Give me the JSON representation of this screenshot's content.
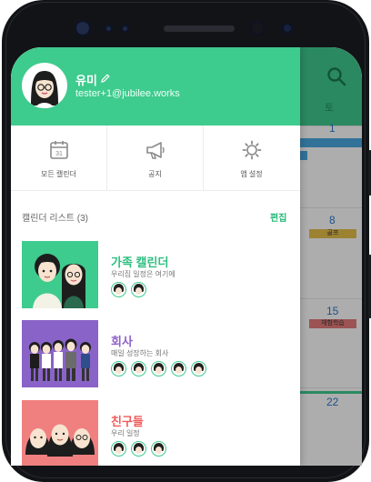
{
  "calendar_bg": {
    "weekday_label": "토",
    "dates": [
      "1",
      "8",
      "15",
      "22"
    ],
    "chips": [
      "골프",
      "체험학습"
    ],
    "colors": {
      "accent": "#3ecb8e",
      "date": "#2c79c9",
      "chip_blue": "#4aa8e0",
      "chip_yellow": "#e8c04a",
      "chip_red": "#e57b7b"
    }
  },
  "user": {
    "name": "유미",
    "email": "tester+1@jubilee.works"
  },
  "menu": {
    "items": [
      {
        "label": "모든 캘린더",
        "icon": "calendar-31-icon",
        "icon_text": "31"
      },
      {
        "label": "공지",
        "icon": "megaphone-icon"
      },
      {
        "label": "앱 설정",
        "icon": "gear-icon"
      }
    ]
  },
  "calendar_list": {
    "title": "캘린더 리스트 (3)",
    "edit_label": "편집",
    "items": [
      {
        "name": "가족 캘린더",
        "desc": "우리집 일정은 여기에",
        "color": "#2fbf7f",
        "thumb_bg": "#3ecb8e",
        "member_count": 2
      },
      {
        "name": "회사",
        "desc": "매일 성장하는 회사",
        "color": "#8f63c9",
        "thumb_bg": "#8a63c8",
        "member_count": 5
      },
      {
        "name": "친구들",
        "desc": "우리 일정",
        "color": "#ee5a5a",
        "thumb_bg": "#f08080",
        "member_count": 3
      }
    ]
  }
}
